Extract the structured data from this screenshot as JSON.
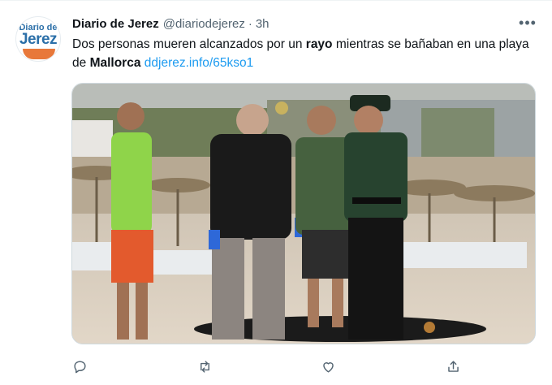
{
  "tweet": {
    "author_name": "Diario de Jerez",
    "handle": "@diariodejerez",
    "separator": "·",
    "time": "3h",
    "text_part1": "Dos personas mueren alcanzados por un ",
    "text_bold1": "rayo",
    "text_part2": " mientras se bañaban en una playa de ",
    "text_bold2": "Mallorca",
    "text_part3": " ",
    "link": "ddjerez.info/65kso1"
  },
  "avatar": {
    "line1": "Diario de",
    "line2": "Jerez",
    "brand_blue": "#2b6fa8",
    "brand_orange": "#e8783a"
  },
  "more_menu": {
    "glyph": "•••"
  },
  "actions": [
    {
      "name": "reply",
      "icon": "reply-icon"
    },
    {
      "name": "retweet",
      "icon": "retweet-icon"
    },
    {
      "name": "like",
      "icon": "heart-icon"
    },
    {
      "name": "share",
      "icon": "share-icon"
    }
  ],
  "colors": {
    "text": "#0f1419",
    "secondary": "#536471",
    "link": "#1d9bf0",
    "uniform_green": "#1f3a2b"
  }
}
